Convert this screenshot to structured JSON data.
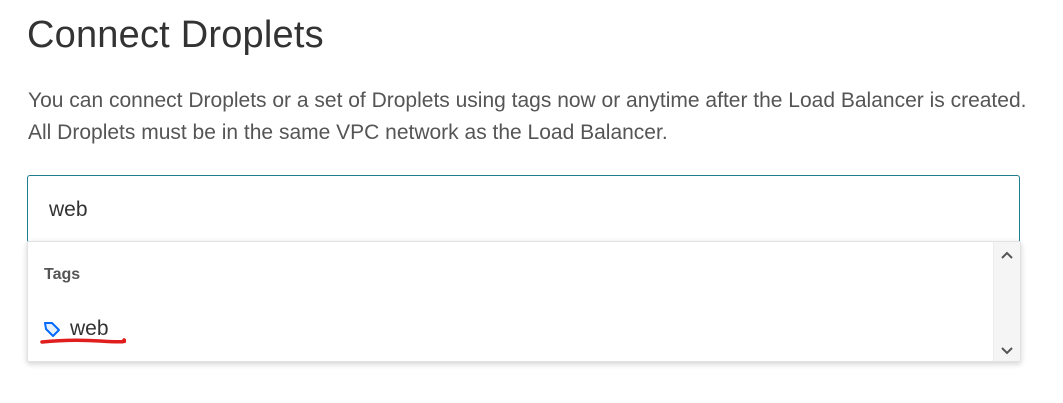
{
  "section": {
    "title": "Connect Droplets",
    "description": "You can connect Droplets or a set of Droplets using tags now or anytime after the Load Balancer is created. All Droplets must be in the same VPC network as the Load Balancer."
  },
  "search": {
    "value": "web"
  },
  "dropdown": {
    "group_label": "Tags",
    "options": [
      {
        "label": "web",
        "icon": "tag-icon"
      }
    ]
  },
  "colors": {
    "focus_border": "#1f7d8c",
    "tag_icon": "#0069ff",
    "annotation_underline": "#e01e1e"
  },
  "icons": {
    "scroll_up": "chevron-up-icon",
    "scroll_down": "chevron-down-icon"
  }
}
